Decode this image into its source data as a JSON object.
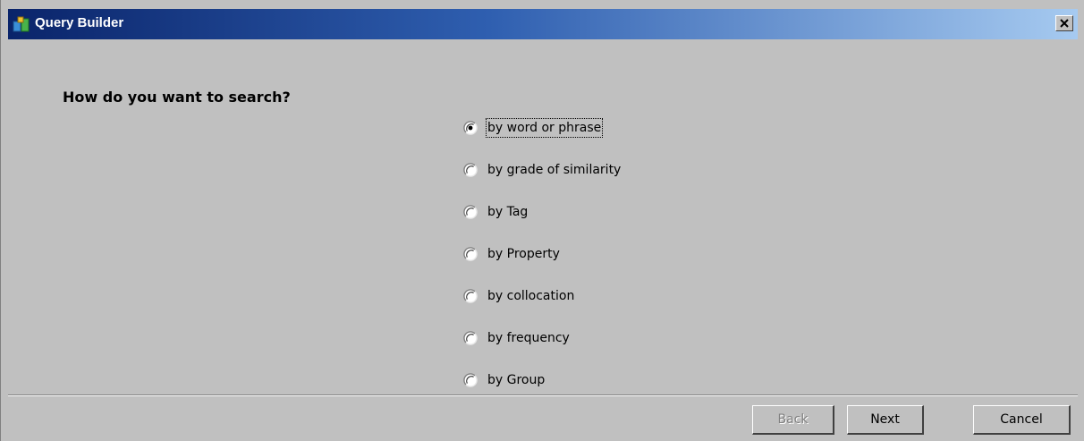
{
  "window": {
    "title": "Query Builder",
    "title_icon": "app-icon",
    "close_icon": "close-icon"
  },
  "prompt": {
    "question": "How do you want to search?"
  },
  "search_options": [
    {
      "label": "by word or phrase",
      "selected": true
    },
    {
      "label": "by grade of similarity",
      "selected": false
    },
    {
      "label": "by Tag",
      "selected": false
    },
    {
      "label": "by Property",
      "selected": false
    },
    {
      "label": "by collocation",
      "selected": false
    },
    {
      "label": "by frequency",
      "selected": false
    },
    {
      "label": "by Group",
      "selected": false
    }
  ],
  "buttons": {
    "back": {
      "label": "Back",
      "enabled": false
    },
    "next": {
      "label": "Next",
      "enabled": true
    },
    "cancel": {
      "label": "Cancel",
      "enabled": true
    }
  },
  "colors": {
    "titlebar_start": "#0a246a",
    "titlebar_end": "#a6caf0",
    "window_background": "#c0c0c0"
  }
}
